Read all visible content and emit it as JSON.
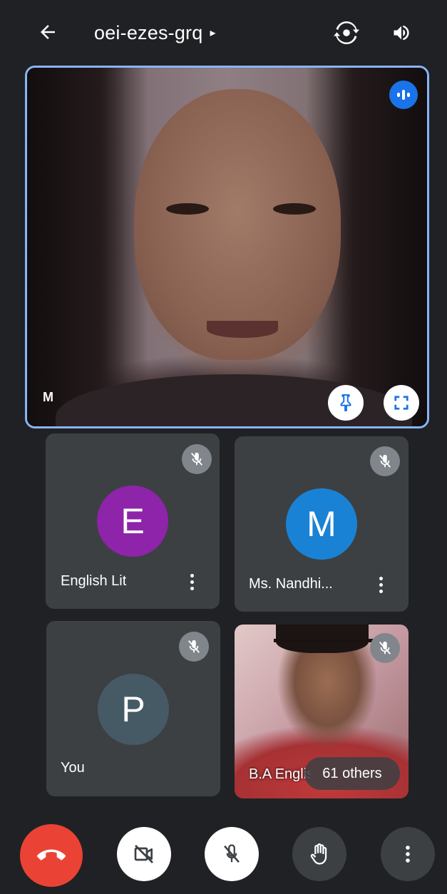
{
  "header": {
    "meeting_code": "oei-ezes-grq",
    "caret": "▸"
  },
  "main_tile": {
    "participant_initial": "M"
  },
  "participants": [
    {
      "initial": "E",
      "name": "English Lit",
      "avatar_color": "#8e24aa"
    },
    {
      "initial": "M",
      "name": "Ms. Nandhi...",
      "avatar_color": "#1a82d4"
    },
    {
      "initial": "P",
      "name": "You",
      "avatar_color": "#455a64"
    }
  ],
  "video_tile": {
    "name_partial": "B.A English",
    "others_label": "61 others"
  },
  "colors": {
    "background": "#202124",
    "tile": "#3c4043",
    "active_border": "#8ab4f8",
    "end_call": "#ea4335",
    "speaking_badge": "#1a73e8"
  }
}
